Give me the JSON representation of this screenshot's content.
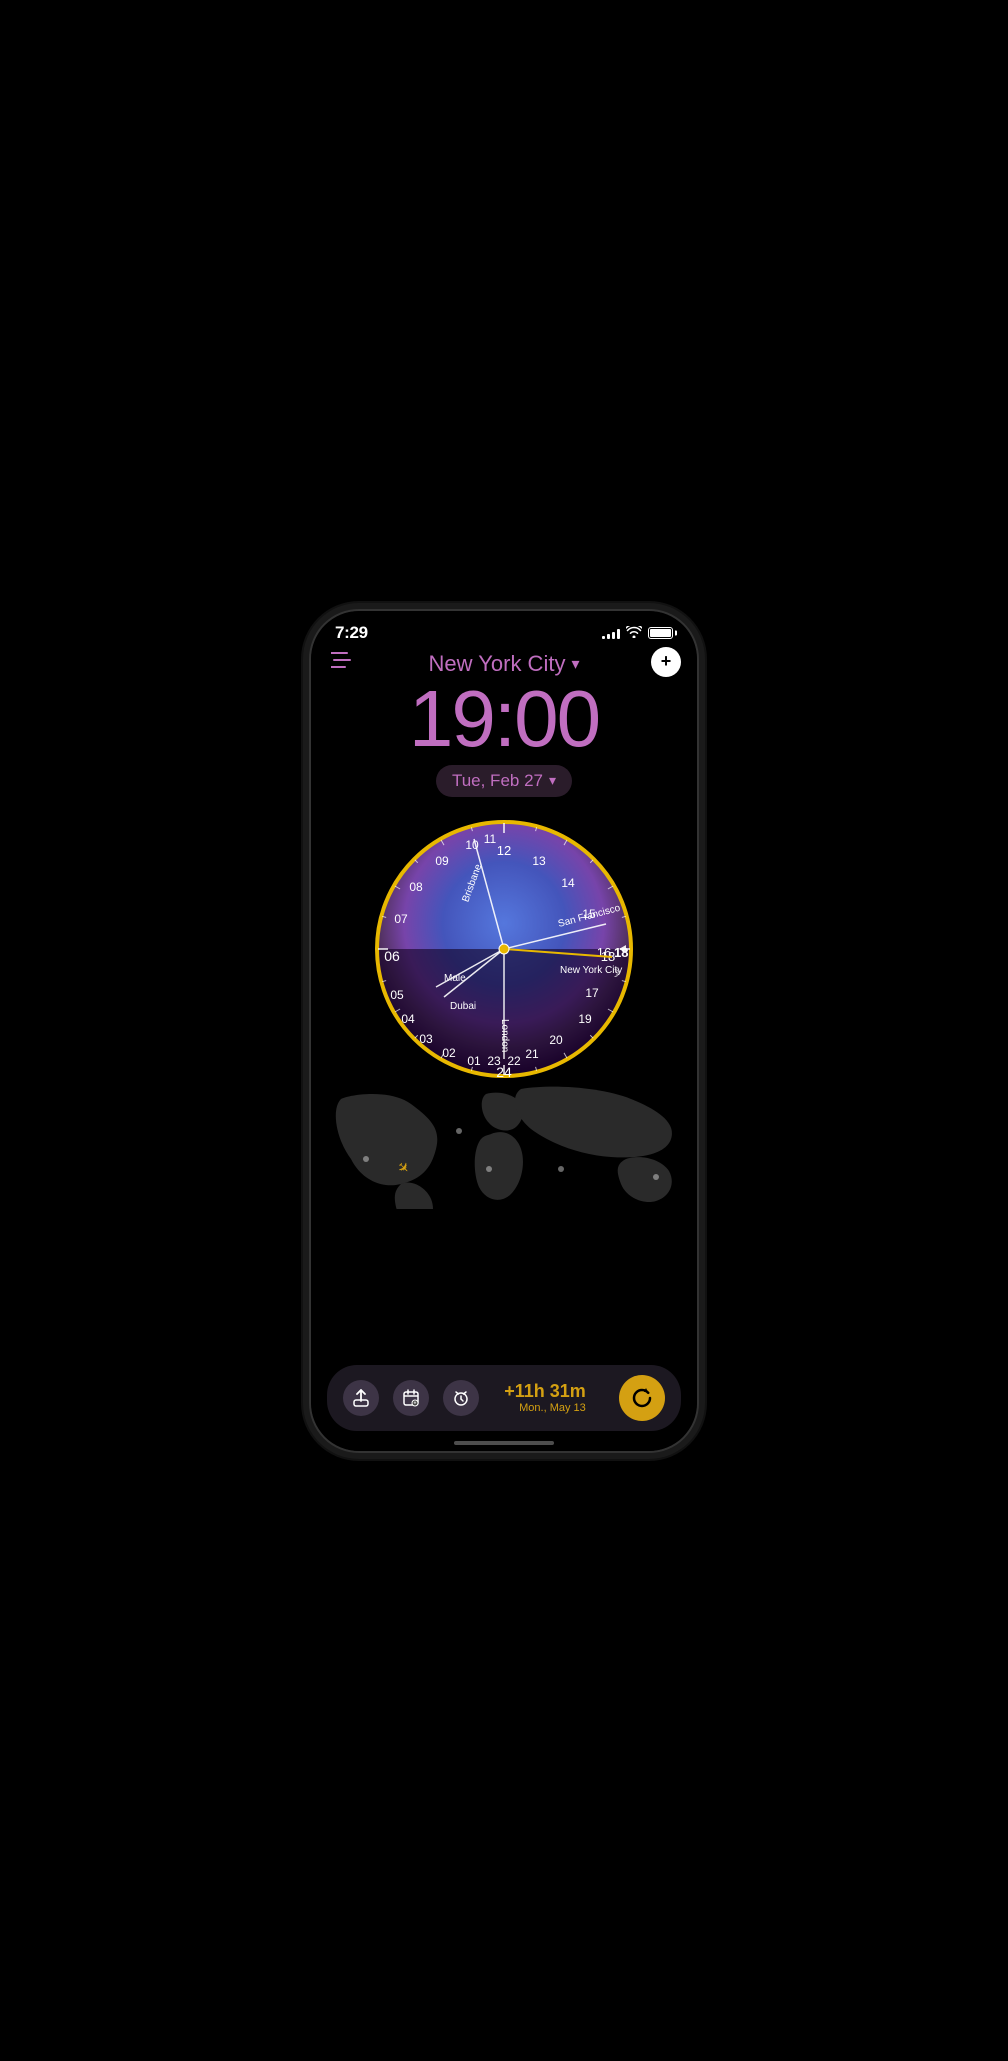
{
  "statusBar": {
    "time": "7:29",
    "signalBars": [
      4,
      6,
      8,
      10,
      12
    ],
    "battery": 100
  },
  "header": {
    "cityName": "New York City",
    "cityChevron": "▾",
    "menuIcon": "≡",
    "addButton": "+",
    "mainTime": "19:00",
    "datePill": "Tue, Feb 27",
    "dateChevron": "▾"
  },
  "clock": {
    "hours": [
      "01",
      "02",
      "03",
      "04",
      "05",
      "06",
      "07",
      "08",
      "09",
      "10",
      "11",
      "12",
      "13",
      "14",
      "15",
      "16",
      "17",
      "18",
      "19",
      "20",
      "21",
      "22",
      "23",
      "24"
    ],
    "cities": [
      {
        "name": "Brisbane",
        "angle": -50
      },
      {
        "name": "San Francisco",
        "angle": 20
      },
      {
        "name": "New York City",
        "angle": 70
      },
      {
        "name": "Male",
        "angle": 165
      },
      {
        "name": "Dubai",
        "angle": 175
      },
      {
        "name": "London",
        "angle": 270
      }
    ]
  },
  "bottomBar": {
    "shareIcon": "⬆",
    "calendarIcon": "📅",
    "alarmIcon": "⏰",
    "timeDiff": "+11h 31m",
    "timeDiffDate": "Mon., May 13",
    "refreshIcon": "↻"
  }
}
